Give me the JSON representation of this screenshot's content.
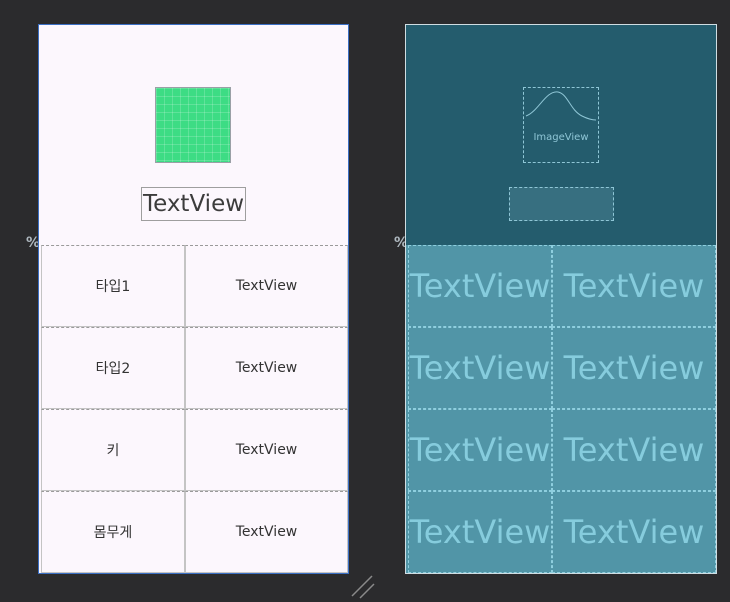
{
  "percent_marker": "%",
  "design": {
    "title_textview": "TextView",
    "rows": [
      {
        "label": "타입1",
        "value": "TextView"
      },
      {
        "label": "타입2",
        "value": "TextView"
      },
      {
        "label": "키",
        "value": "TextView"
      },
      {
        "label": "몸무게",
        "value": "TextView"
      }
    ]
  },
  "blueprint": {
    "image_label": "ImageView",
    "rows": [
      {
        "left": "TextView",
        "right": "TextView"
      },
      {
        "left": "TextView",
        "right": "TextView"
      },
      {
        "left": "TextView",
        "right": "TextView"
      },
      {
        "left": "TextView",
        "right": "TextView"
      }
    ]
  },
  "colors": {
    "accent_green": "#3ddc84",
    "blueprint_bg": "#245c6d",
    "blueprint_cells": "#5195a7",
    "canvas_bg": "#2b2b2d"
  }
}
